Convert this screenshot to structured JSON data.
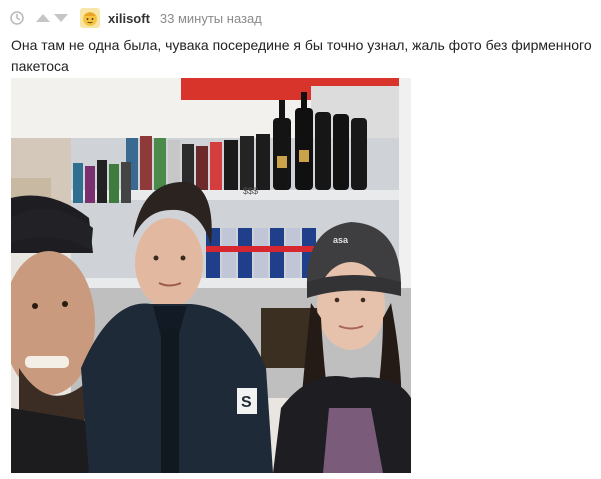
{
  "comment": {
    "username": "xilisoft",
    "time": "33 минуты назад",
    "text": "Она там не одна была, чувака посередине я бы точно узнал, жаль фото без фирменного пакетоса",
    "icons": {
      "time": "clock-icon",
      "upvote": "arrow-up-icon",
      "downvote": "arrow-down-icon",
      "avatar": "avatar-icon"
    },
    "photo": {
      "shelf_sign": "$$$",
      "beanie_text": "asa"
    },
    "colors": {
      "vote_arrow": "#c5c5c5",
      "username": "#333333",
      "time": "#8a8a8a",
      "avatar": "#f5c542"
    }
  }
}
